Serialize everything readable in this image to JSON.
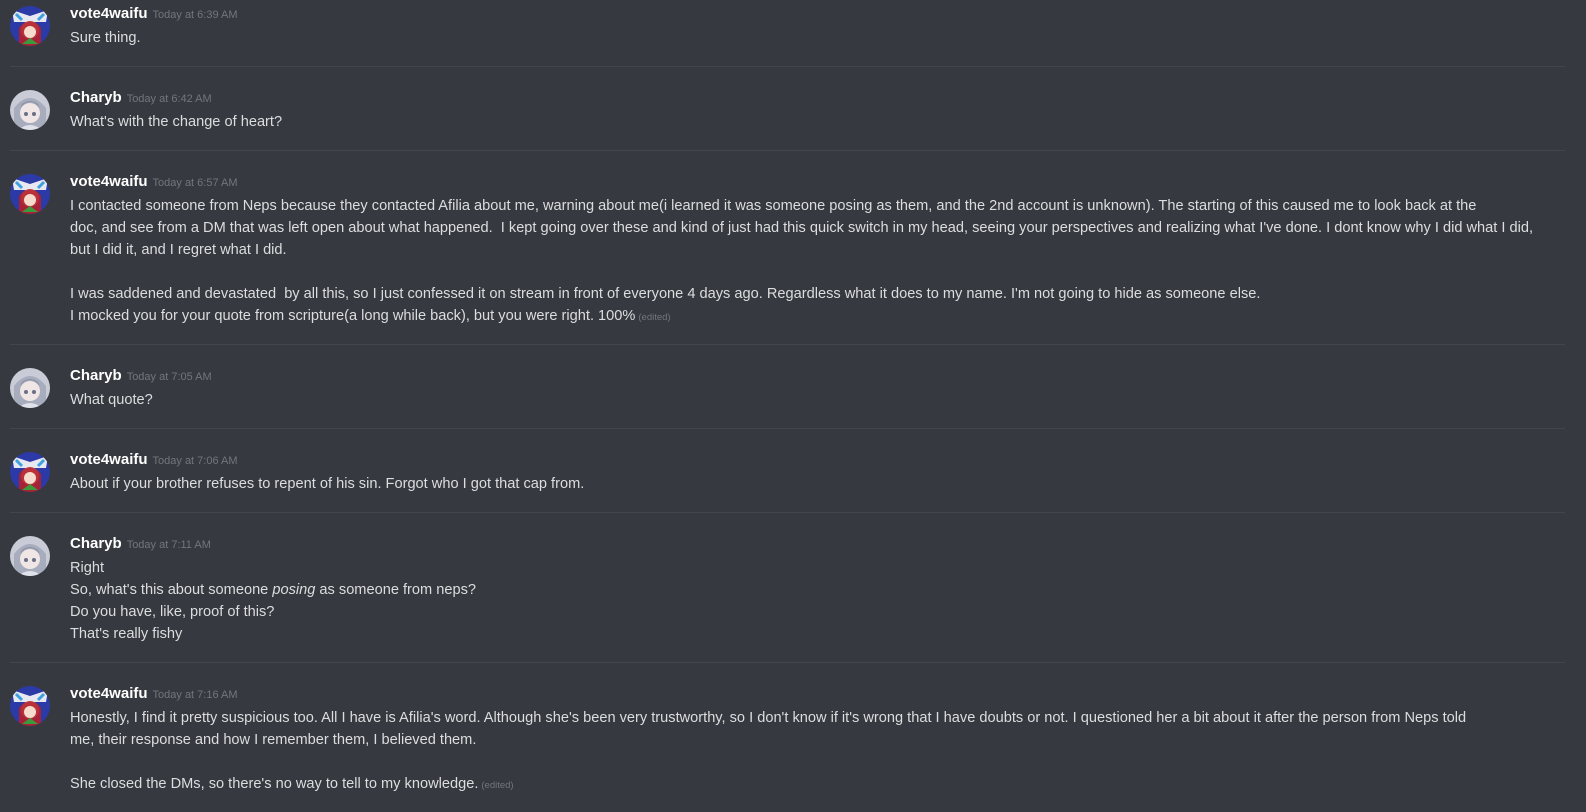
{
  "messages": [
    {
      "author": "vote4waifu",
      "avatar_icon": "vote4waifu-avatar-icon",
      "time": "Today at 6:39 AM",
      "lines": [
        "Sure thing."
      ]
    },
    {
      "author": "Charyb",
      "avatar_icon": "charyb-avatar-icon",
      "time": "Today at 6:42 AM",
      "lines": [
        "What's with the change of heart?"
      ]
    },
    {
      "author": "vote4waifu",
      "avatar_icon": "vote4waifu-avatar-icon",
      "time": "Today at 6:57 AM",
      "lines": [
        "I contacted someone from Neps because they contacted Afilia about me, warning about me(i learned it was someone posing as them, and the 2nd account is unknown). The starting of this caused me to look back at the",
        "doc, and see from a DM that was left open about what happened.  I kept going over these and kind of just had this quick switch in my head, seeing your perspectives and realizing what I've done. I dont know why I did what I did,",
        "but I did it, and I regret what I did.",
        "",
        "I was saddened and devastated  by all this, so I just confessed it on stream in front of everyone 4 days ago. Regardless what it does to my name. I'm not going to hide as someone else.",
        "I mocked you for your quote from scripture(a long while back), but you were right. 100%"
      ],
      "edited_label": "(edited)"
    },
    {
      "author": "Charyb",
      "avatar_icon": "charyb-avatar-icon",
      "time": "Today at 7:05 AM",
      "lines": [
        "What quote?"
      ]
    },
    {
      "author": "vote4waifu",
      "avatar_icon": "vote4waifu-avatar-icon",
      "time": "Today at 7:06 AM",
      "lines": [
        "About if your brother refuses to repent of his sin. Forgot who I got that cap from."
      ]
    },
    {
      "author": "Charyb",
      "avatar_icon": "charyb-avatar-icon",
      "time": "Today at 7:11 AM",
      "lines": [
        "Right",
        "So, what's this about someone posing as someone from neps?",
        "Do you have, like, proof of this?",
        "That's really fishy"
      ],
      "italic_segment": {
        "before": "So, what's this about someone ",
        "italic": "posing",
        "after": " as someone from neps?"
      }
    },
    {
      "author": "vote4waifu",
      "avatar_icon": "vote4waifu-avatar-icon",
      "time": "Today at 7:16 AM",
      "lines": [
        "Honestly, I find it pretty suspicious too. All I have is Afilia's word. Although she's been very trustworthy, so I don't know if it's wrong that I have doubts or not. I questioned her a bit about it after the person from Neps told",
        "me, their response and how I remember them, I believed them.",
        "",
        "She closed the DMs, so there's no way to tell to my knowledge."
      ],
      "edited_label": "(edited)"
    }
  ]
}
